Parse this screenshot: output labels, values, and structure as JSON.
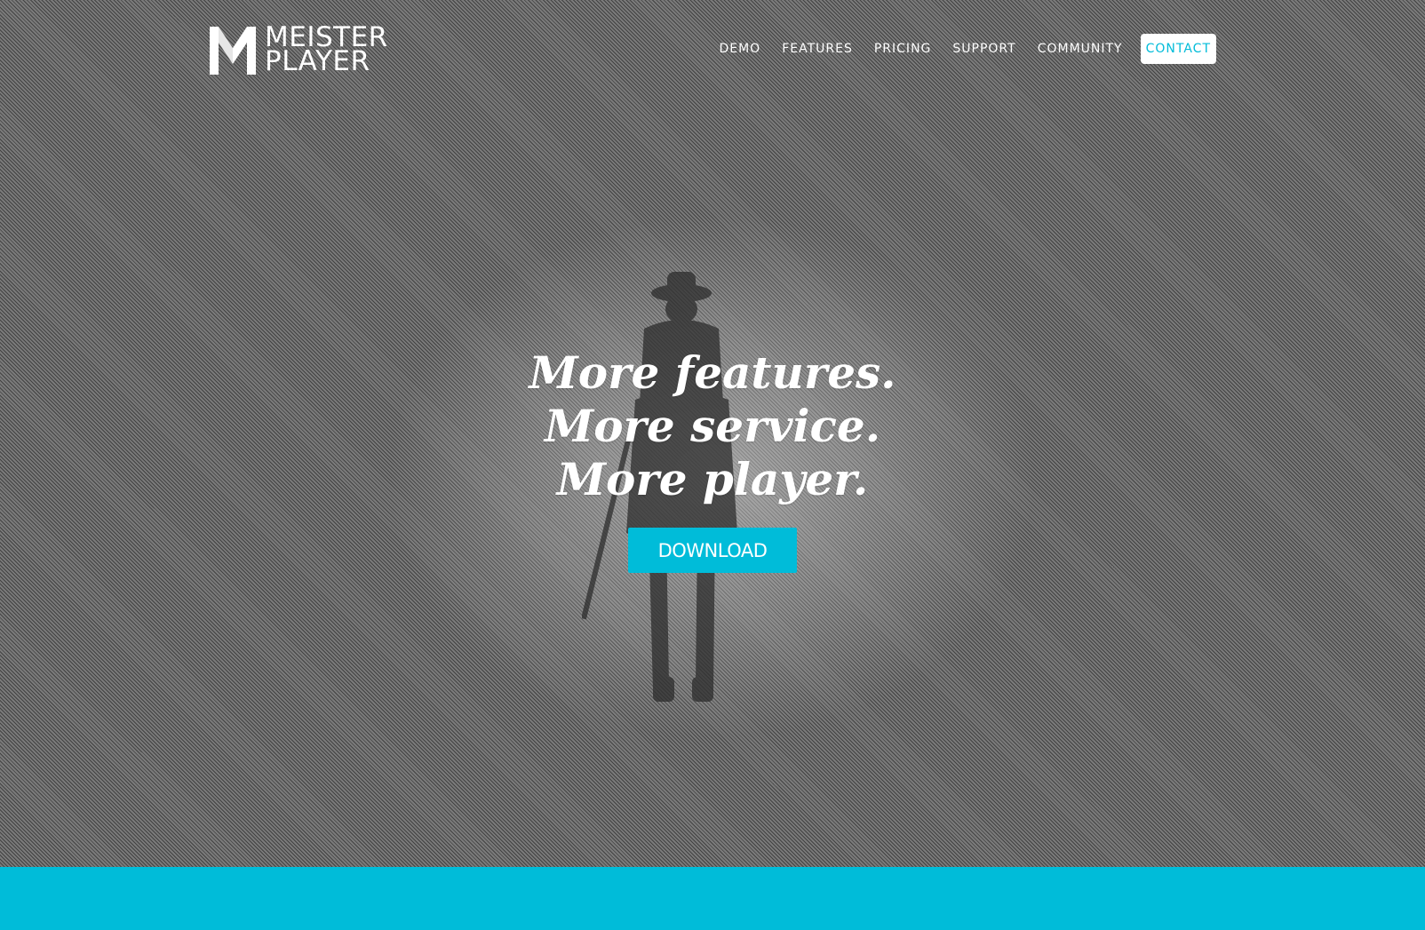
{
  "brand": {
    "line1": "MEISTER",
    "line2": "PLAYER",
    "logo_icon": "m-logo-icon"
  },
  "nav": {
    "items": [
      {
        "label": "DEMO"
      },
      {
        "label": "FEATURES"
      },
      {
        "label": "PRICING"
      },
      {
        "label": "SUPPORT"
      },
      {
        "label": "COMMUNITY"
      }
    ],
    "contact": "CONTACT"
  },
  "hero": {
    "lines": [
      "More features.",
      "More service.",
      "More player."
    ],
    "cta": "DOWNLOAD"
  },
  "colors": {
    "accent": "#00bcd9",
    "text": "#ffffff"
  }
}
